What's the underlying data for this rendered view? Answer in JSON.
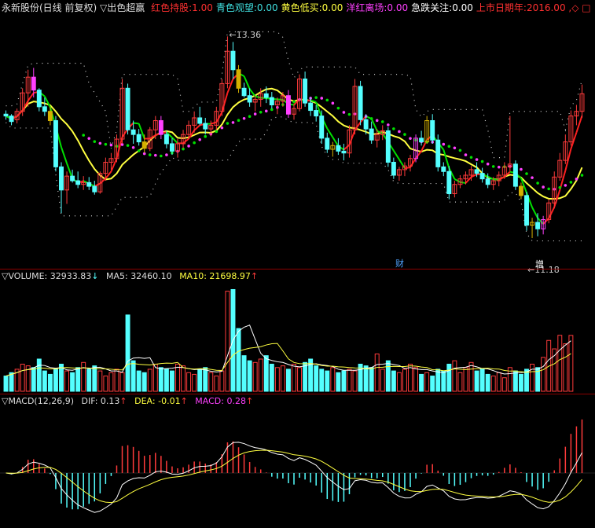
{
  "main_header": {
    "stock_name": "永新股份(日线 前复权)",
    "indicator": "▽出色超赢",
    "items": [
      {
        "label": "红色持股:",
        "value": "1.00",
        "color": "#ff3030"
      },
      {
        "label": "青色观望:",
        "value": "0.00",
        "color": "#40e0e0"
      },
      {
        "label": "黄色低买:",
        "value": "0.00",
        "color": "#ffff40"
      },
      {
        "label": "洋红离场:",
        "value": "0.00",
        "color": "#ff40ff"
      },
      {
        "label": "急跌关注:",
        "value": "0.00",
        "color": "#ffffff"
      },
      {
        "label": "上市日期年:",
        "value": "2016.00",
        "color": "#ff3030"
      }
    ],
    "trailing": ",◇ □"
  },
  "price_labels": {
    "high": "13.36",
    "low": "11.18"
  },
  "event_markers": [
    {
      "text": "财",
      "color": "#4fa3ff"
    },
    {
      "text": "增",
      "color": "#ffffff"
    }
  ],
  "volume_header": {
    "name": "▽VOLUME:",
    "value": "32933.83",
    "value_arrow": "↓",
    "ma5_label": "MA5:",
    "ma5_value": "32460.10",
    "ma10_label": "MA10:",
    "ma10_value": "21698.97",
    "ma10_arrow": "↑"
  },
  "macd_header": {
    "name": "▽MACD(12,26,9)",
    "dif_label": "DIF:",
    "dif_value": "0.13",
    "dif_arrow": "↑",
    "dea_label": "DEA:",
    "dea_value": "-0.01",
    "dea_arrow": "↑",
    "macd_label": "MACD:",
    "macd_value": "0.28",
    "macd_arrow": "↑"
  },
  "colors": {
    "up": "#ff3b3b",
    "down": "#54ffff",
    "yellow_candle": "#d4b000",
    "magenta": "#ff40ff",
    "ma_yellow": "#ffff40",
    "ma_green": "#00e000",
    "ma_red": "#ff2020",
    "dotted": "#cccccc",
    "background": "#000000"
  },
  "chart_data": [
    {
      "type": "candlestick",
      "price_range": [
        10.9,
        13.55
      ],
      "high_label": 13.36,
      "low_label": 11.18,
      "candles": [
        [
          12.52,
          12.56,
          12.46,
          12.5
        ],
        [
          12.5,
          12.52,
          12.4,
          12.44
        ],
        [
          12.46,
          12.58,
          12.42,
          12.55
        ],
        [
          12.55,
          12.8,
          12.5,
          12.75
        ],
        [
          12.75,
          13.0,
          12.6,
          12.92
        ],
        [
          12.92,
          13.02,
          12.7,
          12.78
        ],
        [
          12.78,
          12.8,
          12.55,
          12.6
        ],
        [
          12.6,
          12.7,
          12.5,
          12.55
        ],
        [
          12.55,
          12.6,
          12.4,
          12.45
        ],
        [
          12.45,
          12.5,
          11.9,
          11.95
        ],
        [
          11.95,
          12.0,
          11.45,
          11.7
        ],
        [
          11.7,
          11.9,
          11.55,
          11.85
        ],
        [
          11.85,
          11.92,
          11.78,
          11.8
        ],
        [
          11.8,
          11.9,
          11.72,
          11.76
        ],
        [
          11.76,
          11.85,
          11.7,
          11.78
        ],
        [
          11.78,
          11.84,
          11.7,
          11.74
        ],
        [
          11.74,
          11.8,
          11.65,
          11.68
        ],
        [
          11.68,
          11.9,
          11.66,
          11.88
        ],
        [
          11.88,
          12.05,
          11.8,
          12.0
        ],
        [
          12.0,
          12.1,
          11.92,
          12.04
        ],
        [
          12.04,
          12.3,
          12.0,
          12.25
        ],
        [
          12.25,
          12.9,
          12.2,
          12.8
        ],
        [
          12.8,
          12.85,
          12.3,
          12.35
        ],
        [
          12.35,
          12.45,
          12.2,
          12.3
        ],
        [
          12.3,
          12.36,
          12.18,
          12.22
        ],
        [
          12.22,
          12.3,
          12.1,
          12.15
        ],
        [
          12.15,
          12.38,
          12.12,
          12.35
        ],
        [
          12.35,
          12.5,
          12.25,
          12.45
        ],
        [
          12.45,
          12.5,
          12.25,
          12.3
        ],
        [
          12.3,
          12.34,
          12.15,
          12.2
        ],
        [
          12.2,
          12.26,
          12.08,
          12.12
        ],
        [
          12.12,
          12.25,
          12.05,
          12.2
        ],
        [
          12.2,
          12.35,
          12.15,
          12.3
        ],
        [
          12.3,
          12.45,
          12.25,
          12.4
        ],
        [
          12.4,
          12.55,
          12.32,
          12.48
        ],
        [
          12.48,
          12.6,
          12.4,
          12.42
        ],
        [
          12.42,
          12.48,
          12.3,
          12.36
        ],
        [
          12.36,
          12.45,
          12.28,
          12.4
        ],
        [
          12.4,
          12.6,
          12.35,
          12.55
        ],
        [
          12.55,
          12.9,
          12.5,
          12.85
        ],
        [
          12.85,
          13.36,
          12.8,
          13.2
        ],
        [
          13.2,
          13.3,
          12.9,
          13.0
        ],
        [
          13.0,
          13.05,
          12.75,
          12.8
        ],
        [
          12.8,
          12.86,
          12.7,
          12.72
        ],
        [
          12.72,
          12.8,
          12.6,
          12.65
        ],
        [
          12.65,
          12.72,
          12.55,
          12.68
        ],
        [
          12.68,
          12.8,
          12.6,
          12.74
        ],
        [
          12.74,
          12.82,
          12.64,
          12.7
        ],
        [
          12.7,
          12.76,
          12.58,
          12.62
        ],
        [
          12.62,
          12.7,
          12.52,
          12.66
        ],
        [
          12.66,
          12.76,
          12.6,
          12.72
        ],
        [
          12.72,
          12.78,
          12.48,
          12.52
        ],
        [
          12.52,
          12.62,
          12.46,
          12.58
        ],
        [
          12.58,
          12.95,
          12.55,
          12.9
        ],
        [
          12.9,
          12.98,
          12.6,
          12.64
        ],
        [
          12.64,
          12.7,
          12.5,
          12.56
        ],
        [
          12.56,
          12.62,
          12.44,
          12.5
        ],
        [
          12.5,
          12.56,
          12.2,
          12.26
        ],
        [
          12.26,
          12.32,
          12.1,
          12.14
        ],
        [
          12.14,
          12.22,
          12.06,
          12.18
        ],
        [
          12.18,
          12.26,
          12.08,
          12.12
        ],
        [
          12.12,
          12.2,
          12.02,
          12.1
        ],
        [
          12.1,
          12.4,
          12.05,
          12.35
        ],
        [
          12.35,
          12.9,
          12.3,
          12.82
        ],
        [
          12.82,
          12.88,
          12.4,
          12.46
        ],
        [
          12.46,
          12.52,
          12.3,
          12.36
        ],
        [
          12.36,
          12.44,
          12.2,
          12.24
        ],
        [
          12.24,
          12.36,
          12.16,
          12.3
        ],
        [
          12.3,
          12.4,
          12.24,
          12.34
        ],
        [
          12.34,
          12.38,
          11.95,
          12.0
        ],
        [
          12.0,
          12.05,
          11.82,
          11.86
        ],
        [
          11.86,
          11.95,
          11.8,
          11.92
        ],
        [
          11.92,
          12.0,
          11.85,
          11.96
        ],
        [
          11.96,
          12.08,
          11.9,
          12.04
        ],
        [
          12.04,
          12.3,
          12.0,
          12.26
        ],
        [
          12.26,
          12.34,
          12.18,
          12.22
        ],
        [
          12.22,
          12.5,
          12.2,
          12.45
        ],
        [
          12.45,
          12.52,
          12.2,
          12.24
        ],
        [
          12.24,
          12.3,
          11.9,
          11.95
        ],
        [
          11.95,
          12.0,
          11.85,
          11.9
        ],
        [
          11.9,
          11.96,
          11.6,
          11.66
        ],
        [
          11.66,
          11.8,
          11.62,
          11.76
        ],
        [
          11.76,
          11.86,
          11.72,
          11.82
        ],
        [
          11.82,
          11.9,
          11.76,
          11.86
        ],
        [
          11.86,
          11.96,
          11.8,
          11.92
        ],
        [
          11.92,
          12.0,
          11.84,
          11.88
        ],
        [
          11.88,
          11.94,
          11.78,
          11.82
        ],
        [
          11.82,
          11.88,
          11.72,
          11.76
        ],
        [
          11.76,
          11.84,
          11.7,
          11.8
        ],
        [
          11.8,
          11.9,
          11.74,
          11.86
        ],
        [
          11.86,
          12.0,
          11.82,
          11.95
        ],
        [
          11.95,
          12.5,
          11.9,
          11.98
        ],
        [
          11.98,
          12.02,
          11.7,
          11.74
        ],
        [
          11.74,
          11.78,
          11.6,
          11.64
        ],
        [
          11.64,
          11.68,
          11.26,
          11.32
        ],
        [
          11.32,
          11.4,
          11.18,
          11.35
        ],
        [
          11.35,
          11.45,
          11.2,
          11.28
        ],
        [
          11.28,
          11.42,
          11.22,
          11.38
        ],
        [
          11.38,
          11.6,
          11.34,
          11.56
        ],
        [
          11.56,
          11.9,
          11.5,
          11.84
        ],
        [
          11.84,
          12.1,
          11.8,
          12.02
        ],
        [
          12.02,
          12.3,
          11.98,
          12.22
        ],
        [
          12.22,
          12.56,
          12.18,
          12.5
        ],
        [
          12.5,
          12.62,
          12.4,
          12.55
        ],
        [
          12.55,
          12.84,
          12.48,
          12.74
        ]
      ]
    },
    {
      "type": "bar",
      "name": "VOLUME",
      "values": [
        9000,
        11000,
        13000,
        16000,
        15000,
        14000,
        19000,
        12000,
        10000,
        13000,
        16000,
        12000,
        11000,
        14000,
        17000,
        13000,
        15000,
        12000,
        9000,
        11000,
        13000,
        11000,
        45000,
        18000,
        12000,
        11000,
        13000,
        16000,
        14000,
        13000,
        12000,
        16000,
        15000,
        11000,
        10000,
        13000,
        14000,
        11000,
        9000,
        12000,
        59000,
        60000,
        37000,
        21000,
        18000,
        17000,
        19000,
        21000,
        16000,
        14000,
        15000,
        13000,
        16000,
        14000,
        17000,
        19000,
        15000,
        13000,
        12000,
        14000,
        11000,
        12000,
        13000,
        12000,
        16000,
        15000,
        14000,
        22000,
        13000,
        18000,
        12000,
        11000,
        13000,
        16000,
        14000,
        10000,
        11000,
        9000,
        13000,
        12000,
        16000,
        18000,
        11000,
        14000,
        17000,
        12000,
        13000,
        10000,
        9000,
        11000,
        8000,
        14000,
        12000,
        10000,
        13000,
        16000,
        14000,
        20000,
        30000,
        25000,
        33000,
        28000,
        32933
      ],
      "ma5": 32460.1,
      "ma10": 21698.97
    },
    {
      "type": "macd",
      "params": [
        12,
        26,
        9
      ],
      "dif": 0.13,
      "dea": -0.01,
      "macd": 0.28
    }
  ]
}
